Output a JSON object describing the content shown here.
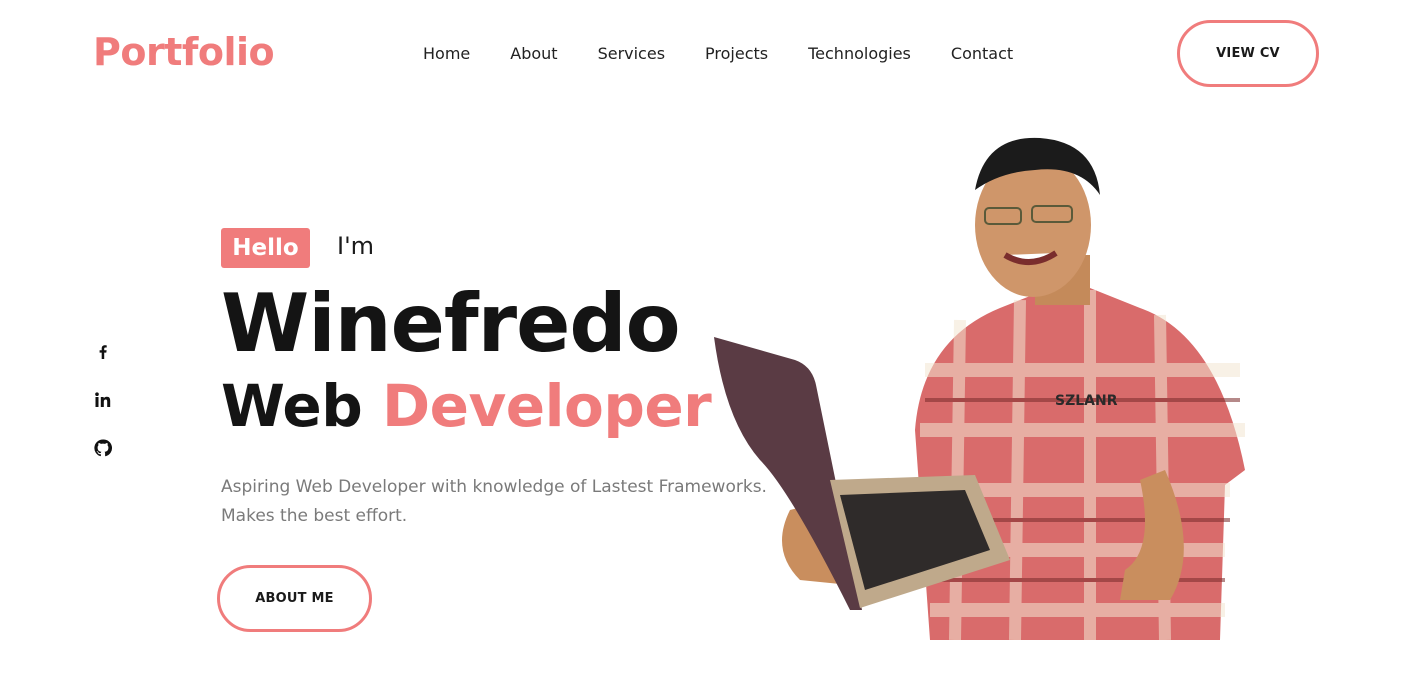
{
  "brand": {
    "logo": "Portfolio",
    "accent_color": "#f07c7c"
  },
  "nav": {
    "items": [
      {
        "label": "Home"
      },
      {
        "label": "About"
      },
      {
        "label": "Services"
      },
      {
        "label": "Projects"
      },
      {
        "label": "Technologies"
      },
      {
        "label": "Contact"
      }
    ],
    "cta_label": "VIEW CV"
  },
  "social": [
    {
      "icon": "facebook-icon"
    },
    {
      "icon": "linkedin-icon"
    },
    {
      "icon": "github-icon"
    }
  ],
  "hero": {
    "badge": "Hello",
    "greeting": "I'm",
    "name": "Winefredo",
    "role_prefix": "Web",
    "role_accent": "Developer",
    "tagline_line1": "Aspiring Web Developer with knowledge of Lastest Frameworks.",
    "tagline_line2": "Makes the best effort.",
    "button_label": "ABOUT ME",
    "image": {
      "subject": "smiling man in plaid shirt holding a laptop",
      "shirt_text": "SZLANR"
    }
  }
}
